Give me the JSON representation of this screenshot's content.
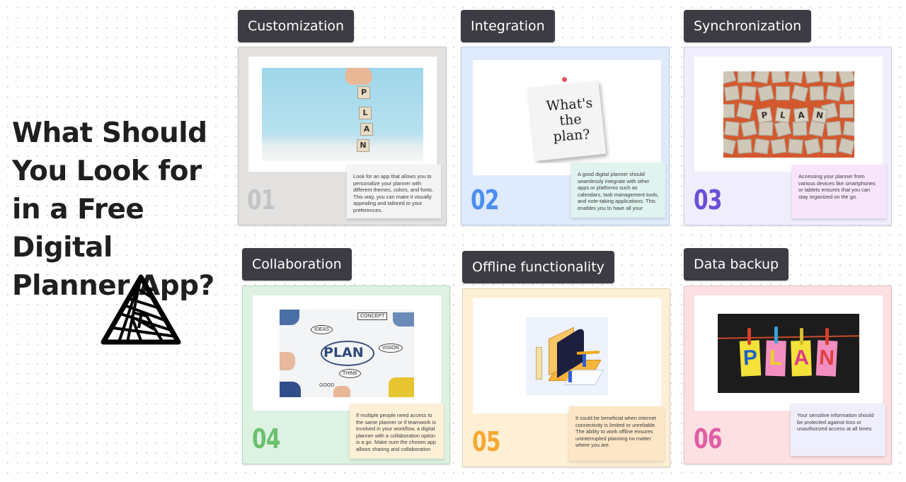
{
  "title": "What Should You Look for in a Free Digital Planner App?",
  "logo": "triangle-spiral-logo",
  "cards": [
    {
      "number": "01",
      "label": "Customization",
      "description": "Look for an app that allows you to personalize your planner with different themes, colors, and fonts. This way, you can make it visually appealing and tailored to your preferences.",
      "image": "hand-placing-plan-letter-blocks",
      "image_text": [
        "P",
        "L",
        "A",
        "N"
      ],
      "colors": {
        "card_bg": "#e3e2e0",
        "border": "#c7c6c4",
        "number": "#c4c4c4",
        "note_bg": "#f4f4f4"
      }
    },
    {
      "number": "02",
      "label": "Integration",
      "description": "A good digital planner should seamlessly integrate with other apps or platforms such as calendars, task management tools, and note-taking applications. This enables you to have all your",
      "image": "whats-the-plan-pinned-note",
      "image_text": [
        "What's",
        "the",
        "plan?"
      ],
      "colors": {
        "card_bg": "#dfeafd",
        "border": "#bfcde4",
        "number": "#4a8ef0",
        "note_bg": "#dff3ef"
      }
    },
    {
      "number": "03",
      "label": "Synchronization",
      "description": "Accessing your planner from various devices like smartphones or tablets ensures that you can stay organized on the go.",
      "image": "wooden-tiles-spelling-plan",
      "image_text": [
        "P",
        "L",
        "A",
        "N"
      ],
      "colors": {
        "card_bg": "#f0eefc",
        "border": "#cfcce0",
        "number": "#6b4fd6",
        "note_bg": "#f8e5fb"
      }
    },
    {
      "number": "04",
      "label": "Collaboration",
      "description": "If multiple people need access to the same planner or if teamwork is involved in your workflow, a digital planner with a collaboration option is a go. Make sure the chosen app allows sharing and collaboration",
      "image": "team-brainstorm-plan-sketch",
      "image_text": [
        "PLAN",
        "IDEAS",
        "VISION",
        "THINK",
        "GOOD",
        "CONCEPT"
      ],
      "colors": {
        "card_bg": "#ddf2e3",
        "border": "#b9d6c1",
        "number": "#6cc06f",
        "note_bg": "#fdf0d7"
      }
    },
    {
      "number": "05",
      "label": "Offline functionality",
      "description": "It could be beneficial when internet connectivity is limited or unreliable. The ability to work offline ensures uninterrupted planning no matter where you are.",
      "image": "folder-calendar-illustration",
      "image_text": [],
      "colors": {
        "card_bg": "#fdf0d5",
        "border": "#e2d2b0",
        "number": "#f7a833",
        "note_bg": "#fde6c6"
      }
    },
    {
      "number": "06",
      "label": "Data backup",
      "description": "Your sensitive information should be protected against loss or unauthorized access at all times.",
      "image": "plan-notes-clothespins",
      "image_text": [
        "P",
        "L",
        "A",
        "N"
      ],
      "colors": {
        "card_bg": "#fde0e2",
        "border": "#e6c2c5",
        "number": "#e05ea5",
        "note_bg": "#efeefc"
      }
    }
  ]
}
